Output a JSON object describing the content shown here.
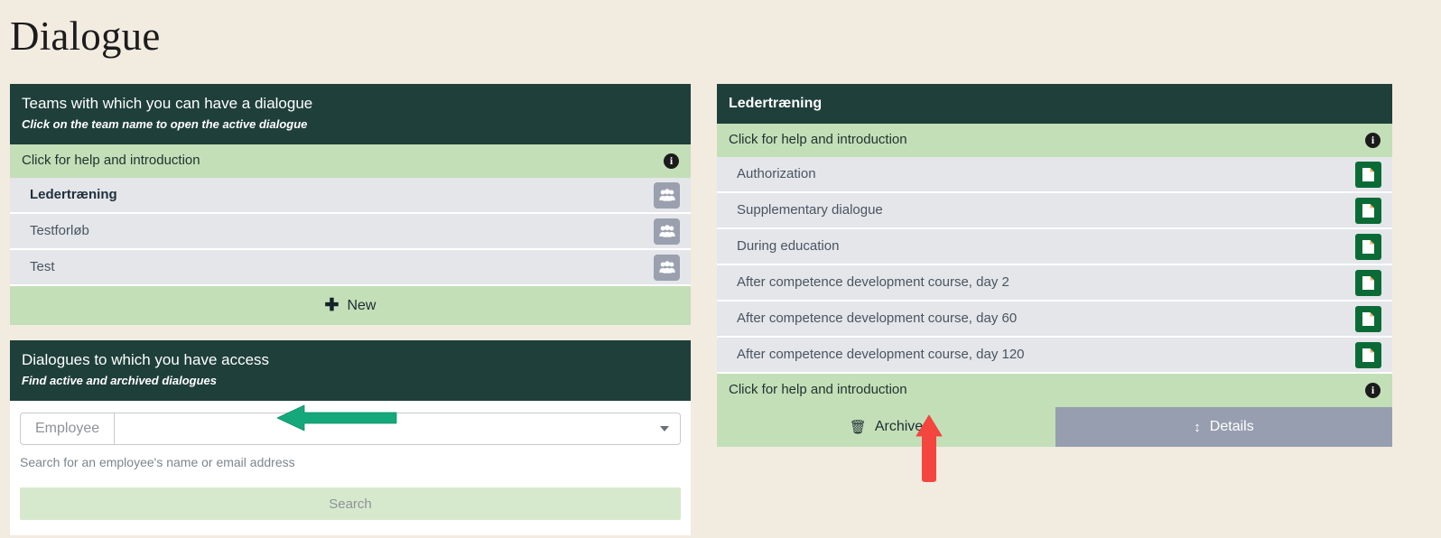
{
  "page": {
    "title": "Dialogue"
  },
  "teams_panel": {
    "header_title": "Teams with which you can have a dialogue",
    "header_subtitle": "Click on the team name to open the active dialogue",
    "help_label": "Click for help and introduction",
    "info_icon": "info-icon",
    "rows": [
      {
        "label": "Ledertræning",
        "icon": "team-icon",
        "active": true
      },
      {
        "label": "Testforløb",
        "icon": "team-icon",
        "active": false
      },
      {
        "label": "Test",
        "icon": "team-icon",
        "active": false
      }
    ],
    "new_button": {
      "icon": "plus-icon",
      "label": "New"
    }
  },
  "access_panel": {
    "header_title": "Dialogues to which you have access",
    "header_subtitle": "Find active and archived dialogues",
    "search": {
      "addon_label": "Employee",
      "value": "",
      "placeholder": "",
      "caret_icon": "chevron-down-icon",
      "hint": "Search for an employee's name or email address",
      "submit_label": "Search"
    }
  },
  "dialogue_panel": {
    "header_title": "Ledertræning",
    "help_label_top": "Click for help and introduction",
    "help_label_bottom": "Click for help and introduction",
    "info_icon": "info-icon",
    "rows": [
      {
        "label": "Authorization",
        "icon": "document-icon"
      },
      {
        "label": "Supplementary dialogue",
        "icon": "document-icon"
      },
      {
        "label": "During education",
        "icon": "document-icon"
      },
      {
        "label": "After competence development course, day 2",
        "icon": "document-icon"
      },
      {
        "label": "After competence development course, day 60",
        "icon": "document-icon"
      },
      {
        "label": "After competence development course, day 120",
        "icon": "document-icon"
      }
    ],
    "archive_button": {
      "icon": "trash-icon",
      "label": "Archive"
    },
    "details_button": {
      "icon": "up-down-arrow-icon",
      "label": "Details"
    }
  },
  "annotations": [
    {
      "name": "green-arrow-annotation",
      "direction": "left",
      "color": "#15a87a"
    },
    {
      "name": "red-arrow-annotation",
      "direction": "up",
      "color": "#f4453e"
    }
  ],
  "colors": {
    "page_background": "#f2ebe0",
    "header_dark": "#1f3f3b",
    "help_green": "#c3dfb8",
    "row_gray": "#e4e6ea",
    "doc_green": "#0b6b37",
    "details_gray": "#979eaf",
    "search_green": "#d7e9cd"
  }
}
